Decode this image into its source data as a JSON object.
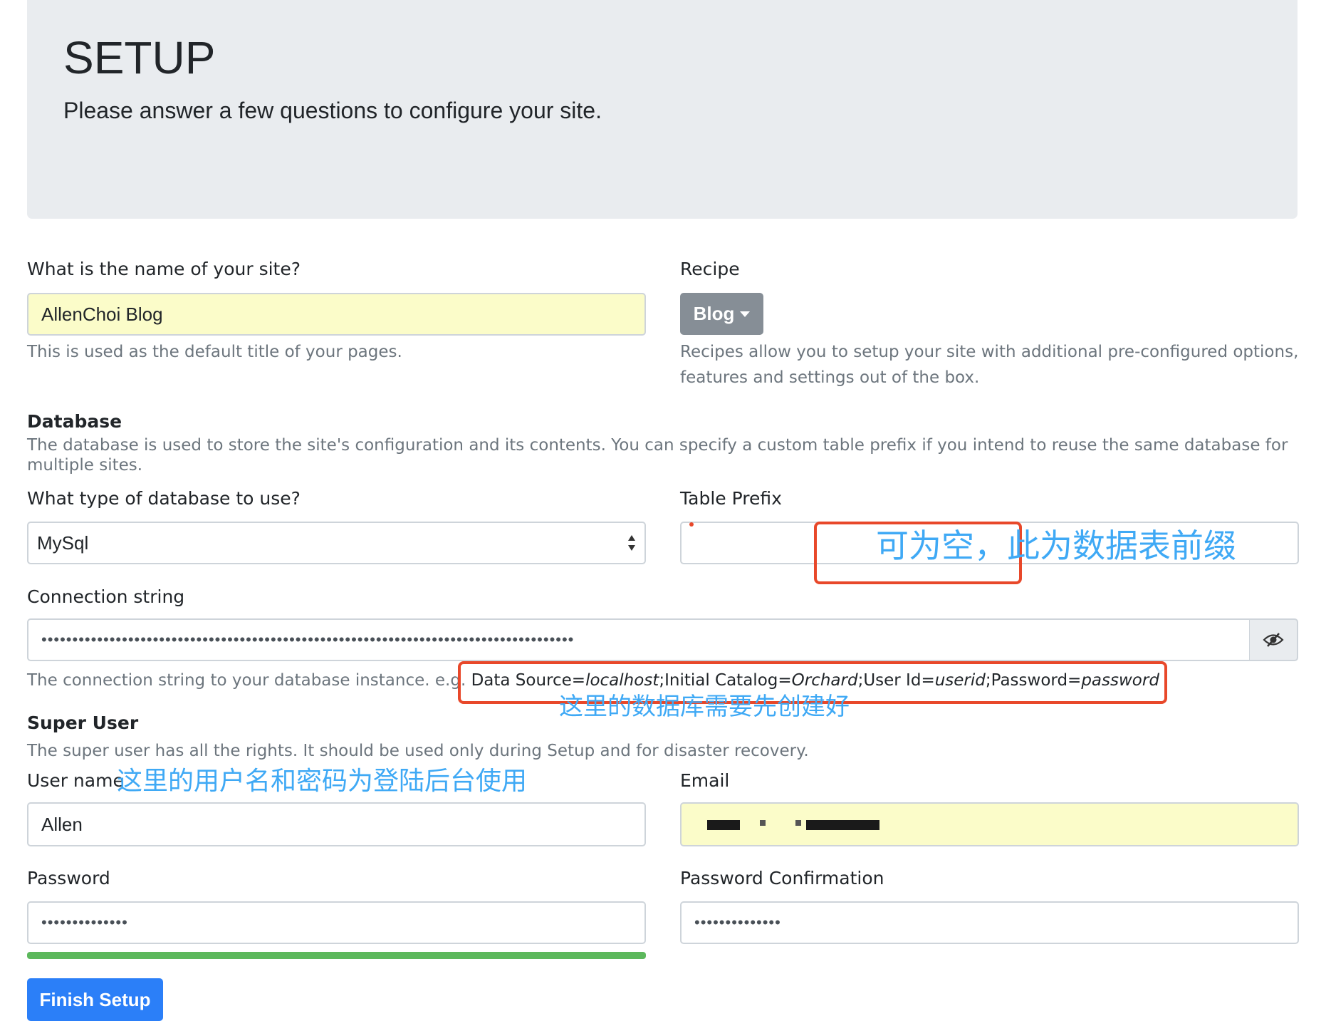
{
  "header": {
    "title": "SETUP",
    "lead": "Please answer a few questions to configure your site."
  },
  "site": {
    "label": "What is the name of your site?",
    "value": "AllenChoi Blog",
    "help": "This is used as the default title of your pages."
  },
  "recipe": {
    "label": "Recipe",
    "selected": "Blog",
    "help": "Recipes allow you to setup your site with additional pre-configured options, features and settings out of the box."
  },
  "database": {
    "title": "Database",
    "help": "The database is used to store the site's configuration and its contents. You can specify a custom table prefix if you intend to reuse the same database for multiple sites.",
    "type_label": "What type of database to use?",
    "type_value": "MySql",
    "prefix_label": "Table Prefix",
    "prefix_value": "",
    "conn_label": "Connection string",
    "conn_mask": "••••••••••••••••••••••••••••••••••••••••••••••••••••••••••••••••••••••••••••••••••••••",
    "conn_help_prefix": "The connection string to your database instance. e.g.",
    "conn_example": {
      "p1": "Data Source=",
      "v1": "localhost",
      "p2": ";Initial Catalog=",
      "v2": "Orchard",
      "p3": ";User Id=",
      "v3": "userid",
      "p4": ";Password=",
      "v4": "password"
    }
  },
  "superuser": {
    "title": "Super User",
    "help": "The super user has all the rights. It should be used only during Setup and for disaster recovery.",
    "username_label": "User name",
    "username_value": "Allen",
    "email_label": "Email",
    "password_label": "Password",
    "password_mask": "••••••••••••••",
    "confirm_label": "Password Confirmation",
    "confirm_mask": "••••••••••••••"
  },
  "actions": {
    "finish_label": "Finish Setup"
  },
  "annotations": {
    "prefix_note": "可为空，此为数据表前缀",
    "db_note": "这里的数据库需要先创建好",
    "user_note": "这里的用户名和密码为登陆后台使用"
  },
  "colors": {
    "primary": "#2b7ff8",
    "secondary": "#868e96",
    "success": "#5cb85c",
    "annotation_red": "#e8482a",
    "annotation_blue": "#3fa9f5",
    "autofill_yellow": "#fbfcc9"
  }
}
